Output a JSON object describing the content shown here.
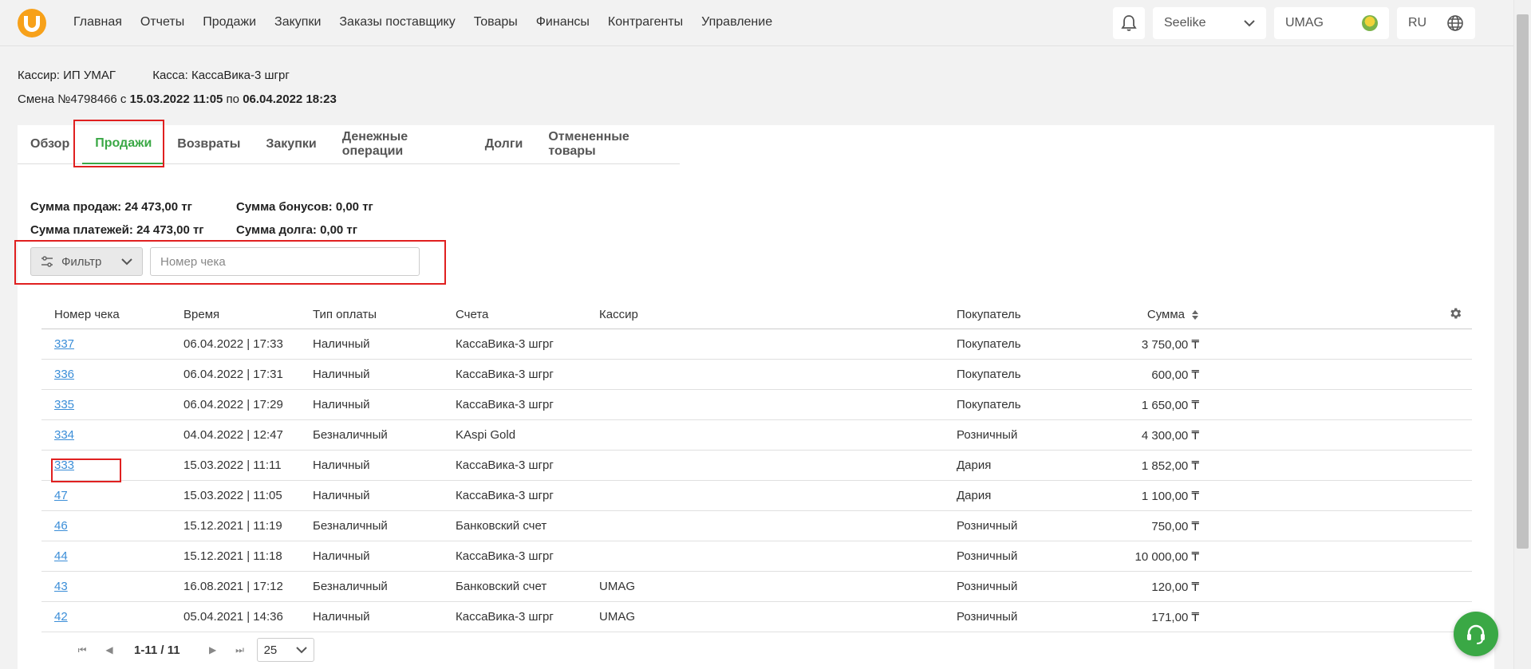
{
  "nav": {
    "items": [
      "Главная",
      "Отчеты",
      "Продажи",
      "Закупки",
      "Заказы поставщику",
      "Товары",
      "Финансы",
      "Контрагенты",
      "Управление"
    ],
    "company": "Seelike",
    "user": "UMAG",
    "lang": "RU"
  },
  "info": {
    "cashier_label": "Кассир: ИП УМАГ",
    "register_label": "Касса: КассаВика-3 шгрг",
    "shift_prefix": "Смена №4798466 с ",
    "shift_start": "15.03.2022 11:05",
    "shift_mid": " по ",
    "shift_end": "06.04.2022 18:23"
  },
  "tabs": [
    "Обзор",
    "Продажи",
    "Возвраты",
    "Закупки",
    "Денежные операции",
    "Долги",
    "Отмененные товары"
  ],
  "active_tab": "Продажи",
  "sums": {
    "sales": "Сумма продаж: 24 473,00 тг",
    "bonuses": "Сумма бонусов: 0,00 тг",
    "payments": "Сумма платежей: 24 473,00 тг",
    "debt": "Сумма долга: 0,00 тг"
  },
  "filter": {
    "label": "Фильтр",
    "search_placeholder": "Номер чека"
  },
  "table": {
    "headers": [
      "Номер чека",
      "Время",
      "Тип оплаты",
      "Счета",
      "Кассир",
      "Покупатель",
      "Сумма"
    ],
    "rows": [
      {
        "num": "337",
        "time": "06.04.2022 | 17:33",
        "pay": "Наличный",
        "acc": "КассаВика-3 шгрг",
        "cashier": "",
        "buyer": "Покупатель",
        "sum": "3 750,00 ₸"
      },
      {
        "num": "336",
        "time": "06.04.2022 | 17:31",
        "pay": "Наличный",
        "acc": "КассаВика-3 шгрг",
        "cashier": "",
        "buyer": "Покупатель",
        "sum": "600,00 ₸"
      },
      {
        "num": "335",
        "time": "06.04.2022 | 17:29",
        "pay": "Наличный",
        "acc": "КассаВика-3 шгрг",
        "cashier": "",
        "buyer": "Покупатель",
        "sum": "1 650,00 ₸"
      },
      {
        "num": "334",
        "time": "04.04.2022 | 12:47",
        "pay": "Безналичный",
        "acc": "KAspi Gold",
        "cashier": "",
        "buyer": "Розничный",
        "sum": "4 300,00 ₸"
      },
      {
        "num": "333",
        "time": "15.03.2022 | 11:11",
        "pay": "Наличный",
        "acc": "КассаВика-3 шгрг",
        "cashier": "",
        "buyer": "Дария",
        "sum": "1 852,00 ₸"
      },
      {
        "num": "47",
        "time": "15.03.2022 | 11:05",
        "pay": "Наличный",
        "acc": "КассаВика-3 шгрг",
        "cashier": "",
        "buyer": "Дария",
        "sum": "1 100,00 ₸"
      },
      {
        "num": "46",
        "time": "15.12.2021 | 11:19",
        "pay": "Безналичный",
        "acc": "Банковский счет",
        "cashier": "",
        "buyer": "Розничный",
        "sum": "750,00 ₸"
      },
      {
        "num": "44",
        "time": "15.12.2021 | 11:18",
        "pay": "Наличный",
        "acc": "КассаВика-3 шгрг",
        "cashier": "",
        "buyer": "Розничный",
        "sum": "10 000,00 ₸"
      },
      {
        "num": "43",
        "time": "16.08.2021 | 17:12",
        "pay": "Безналичный",
        "acc": "Банковский счет",
        "cashier": "UMAG",
        "buyer": "Розничный",
        "sum": "120,00 ₸"
      },
      {
        "num": "42",
        "time": "05.04.2021 | 14:36",
        "pay": "Наличный",
        "acc": "КассаВика-3 шгрг",
        "cashier": "UMAG",
        "buyer": "Розничный",
        "sum": "171,00 ₸"
      }
    ]
  },
  "pager": {
    "range": "1-11 / 11",
    "page_size": "25"
  },
  "colors": {
    "accent_green": "#3aa845",
    "link_blue": "#3b8ed8",
    "highlight_red": "#e02020",
    "logo_orange": "#f7a11a"
  }
}
